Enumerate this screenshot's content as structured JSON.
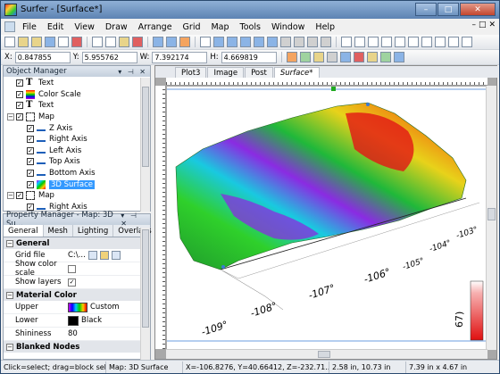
{
  "window": {
    "title": "Surfer - [Surface*]",
    "controls": [
      "–",
      "□",
      "✕"
    ]
  },
  "menu": [
    "File",
    "Edit",
    "View",
    "Draw",
    "Arrange",
    "Grid",
    "Map",
    "Tools",
    "Window",
    "Help"
  ],
  "mdi_controls": [
    "–",
    "□",
    "✕"
  ],
  "coords": {
    "x_label": "X:",
    "x_value": "0.847855",
    "y_label": "Y:",
    "y_value": "5.955762",
    "w_label": "W:",
    "w_value": "7.392174",
    "h_label": "H:",
    "h_value": "4.669819"
  },
  "object_manager": {
    "title": "Object Manager",
    "items": [
      {
        "label": "Text",
        "icon": "text-icon",
        "indent": 1
      },
      {
        "label": "Color Scale",
        "icon": "color-scale-icon",
        "indent": 1
      },
      {
        "label": "Text",
        "icon": "text-icon",
        "indent": 1
      },
      {
        "label": "Map",
        "icon": "map-icon",
        "indent": 0
      },
      {
        "label": "Z Axis",
        "icon": "axis-icon",
        "indent": 2
      },
      {
        "label": "Right Axis",
        "icon": "axis-icon",
        "indent": 2
      },
      {
        "label": "Left Axis",
        "icon": "axis-icon",
        "indent": 2
      },
      {
        "label": "Top Axis",
        "icon": "axis-icon",
        "indent": 2
      },
      {
        "label": "Bottom Axis",
        "icon": "axis-icon",
        "indent": 2
      },
      {
        "label": "3D Surface",
        "icon": "surface-icon",
        "indent": 2,
        "selected": true
      },
      {
        "label": "Map",
        "icon": "map-icon",
        "indent": 0
      },
      {
        "label": "Right Axis",
        "icon": "axis-icon",
        "indent": 2
      }
    ]
  },
  "property_manager": {
    "title": "Property Manager - Map: 3D Su...",
    "tabs": [
      "General",
      "Mesh",
      "Lighting",
      "Overlays"
    ],
    "active_tab": "General",
    "general_header": "General",
    "grid_file_label": "Grid file",
    "grid_file_value": "C:\\...",
    "show_color_scale_label": "Show color scale",
    "show_layers_label": "Show layers",
    "show_layers_checked": "✓",
    "material_header": "Material Color",
    "upper_label": "Upper",
    "upper_value": "Custom",
    "lower_label": "Lower",
    "lower_value": "Black",
    "shininess_label": "Shininess",
    "shininess_value": "80",
    "blanked_header": "Blanked Nodes"
  },
  "document": {
    "tabs": [
      "Plot3",
      "Image",
      "Post",
      "Surface*"
    ],
    "active_tab": "Surface*",
    "axis_labels": [
      "-109°",
      "-108°",
      "-107°",
      "-106°",
      "-105°",
      "-104°",
      "-103°"
    ],
    "colorscale_text": "67)"
  },
  "status": {
    "hint": "Click=select; drag=block sele...",
    "object": "Map: 3D Surface",
    "position": "X=-106.8276, Y=40.66412, Z=-232.71...",
    "size1": "2.58 in, 10.73 in",
    "size2": "7.39 in x 4.67 in"
  }
}
